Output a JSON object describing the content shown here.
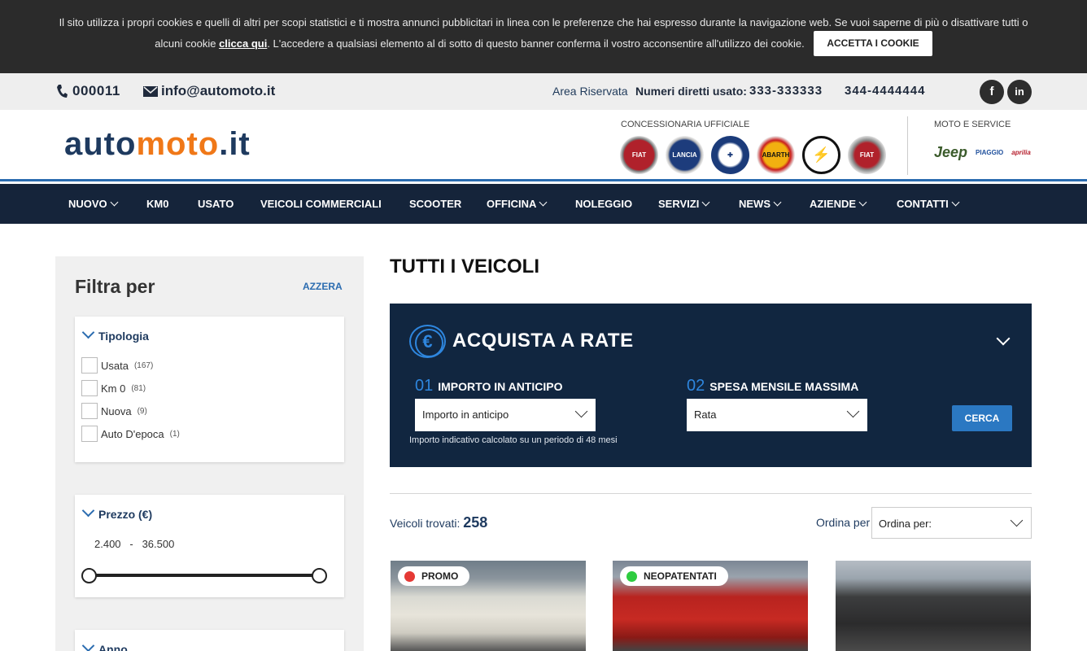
{
  "cookie": {
    "text_line1": "Il sito utilizza i propri cookies e quelli di altri per scopi statistici e ti mostra annunci pubblicitari in linea con le preferenze che hai espresso durante la navigazione web. Se vuoi saperne di più o disattivare tutti o",
    "text_line2_pre": "alcuni cookie ",
    "link": "clicca qui",
    "text_line2_post": ". L'accedere a qualsiasi elemento al di sotto di questo banner conferma il vostro acconsentire all'utilizzo dei cookie.",
    "accept": "ACCETTA I COOKIE"
  },
  "topbar": {
    "phone": "000011",
    "email": "info@automoto.it",
    "area": "Area Riservata",
    "numbers_label": "Numeri diretti usato:",
    "number1": "333-333333",
    "number2": "344-4444444",
    "social": {
      "facebook": "f",
      "linkedin": "in"
    }
  },
  "header": {
    "logo_part1": "auto",
    "logo_part2": "moto",
    "logo_part3": ".it",
    "concessionaria_label": "CONCESSIONARIA UFFICIALE",
    "brands": [
      "FIAT",
      "LANCIA",
      "ALFA ROMEO",
      "ABARTH",
      "OPEL",
      "FIAT PROFESSIONAL"
    ],
    "moto_label": "MOTO E SERVICE",
    "moto_brands": [
      "Jeep",
      "PIAGGIO",
      "aprilia Vespa"
    ]
  },
  "nav": {
    "items": [
      {
        "label": "NUOVO",
        "dropdown": true
      },
      {
        "label": "KM0",
        "dropdown": false
      },
      {
        "label": "USATO",
        "dropdown": false
      },
      {
        "label": "VEICOLI COMMERCIALI",
        "dropdown": false
      },
      {
        "label": "SCOOTER",
        "dropdown": false
      },
      {
        "label": "OFFICINA",
        "dropdown": true
      },
      {
        "label": "NOLEGGIO",
        "dropdown": false
      },
      {
        "label": "SERVIZI",
        "dropdown": true
      },
      {
        "label": "NEWS",
        "dropdown": true
      },
      {
        "label": "AZIENDE",
        "dropdown": true
      },
      {
        "label": "CONTATTI",
        "dropdown": true
      }
    ]
  },
  "sidebar": {
    "title": "Filtra per",
    "reset": "AZZERA",
    "tipologia": {
      "title": "Tipologia",
      "options": [
        {
          "label": "Usata",
          "count": "(167)"
        },
        {
          "label": "Km 0",
          "count": "(81)"
        },
        {
          "label": "Nuova",
          "count": "(9)"
        },
        {
          "label": "Auto D'epoca",
          "count": "(1)"
        }
      ]
    },
    "prezzo": {
      "title": "Prezzo (€)",
      "min": "2.400",
      "separator": "-",
      "max": "36.500"
    },
    "anno": {
      "title": "Anno"
    }
  },
  "main": {
    "title": "TUTTI I VEICOLI",
    "rate": {
      "title": "ACQUISTA A RATE",
      "step1_num": "01",
      "step1_label": "IMPORTO IN ANTICIPO",
      "step1_value": "Importo in anticipo",
      "step2_num": "02",
      "step2_label": "SPESA MENSILE MASSIMA",
      "step2_value": "Rata",
      "note": "Importo indicativo calcolato su un periodo di 48 mesi",
      "button": "CERCA"
    },
    "found_label": "Veicoli trovati:",
    "found_count": "258",
    "order_label": "Ordina per",
    "order_value": "Ordina per:",
    "cards": [
      {
        "badge": "PROMO",
        "badge_color": "#e53935"
      },
      {
        "badge": "NEOPATENTATI",
        "badge_color": "#2ecc40"
      },
      {
        "badge": "",
        "badge_color": ""
      }
    ]
  }
}
